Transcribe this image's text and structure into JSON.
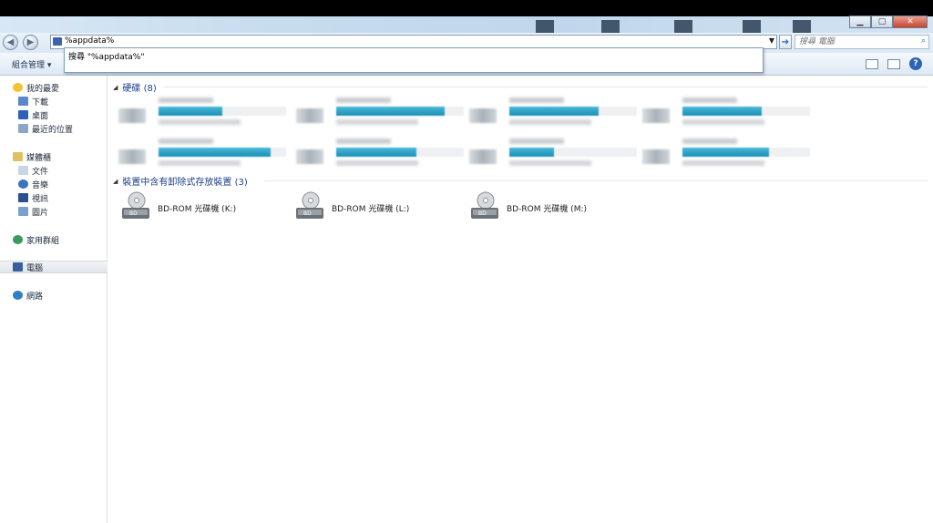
{
  "address": {
    "value": "%appdata%",
    "suggestion": "搜尋 \"%appdata%\""
  },
  "search": {
    "placeholder": "搜尋 電腦"
  },
  "toolbar": {
    "organize": "組合管理 ▾"
  },
  "sidebar": {
    "favorites": "我的最愛",
    "downloads": "下載",
    "desktop": "桌面",
    "recent": "最近的位置",
    "libraries": "媒體櫃",
    "documents": "文件",
    "music": "音樂",
    "videos": "視訊",
    "pictures": "圖片",
    "homegroup": "家用群組",
    "computer": "電腦",
    "network": "網路"
  },
  "groups": {
    "harddisks": "硬碟 (8)",
    "removable": "裝置中含有卸除式存放裝置 (3)"
  },
  "hard_disks": [
    {
      "fill": 0.5
    },
    {
      "fill": 0.85
    },
    {
      "fill": 0.7
    },
    {
      "fill": 0.62
    },
    {
      "fill": 0.88
    },
    {
      "fill": 0.63
    },
    {
      "fill": 0.35
    },
    {
      "fill": 0.68
    }
  ],
  "discs": [
    {
      "label": "BD-ROM 光碟機 (K:)"
    },
    {
      "label": "BD-ROM 光碟機 (L:)"
    },
    {
      "label": "BD-ROM 光碟機 (M:)"
    }
  ],
  "colors": {
    "accent": "#1e3f8a",
    "bar": "#1a8fb8"
  }
}
